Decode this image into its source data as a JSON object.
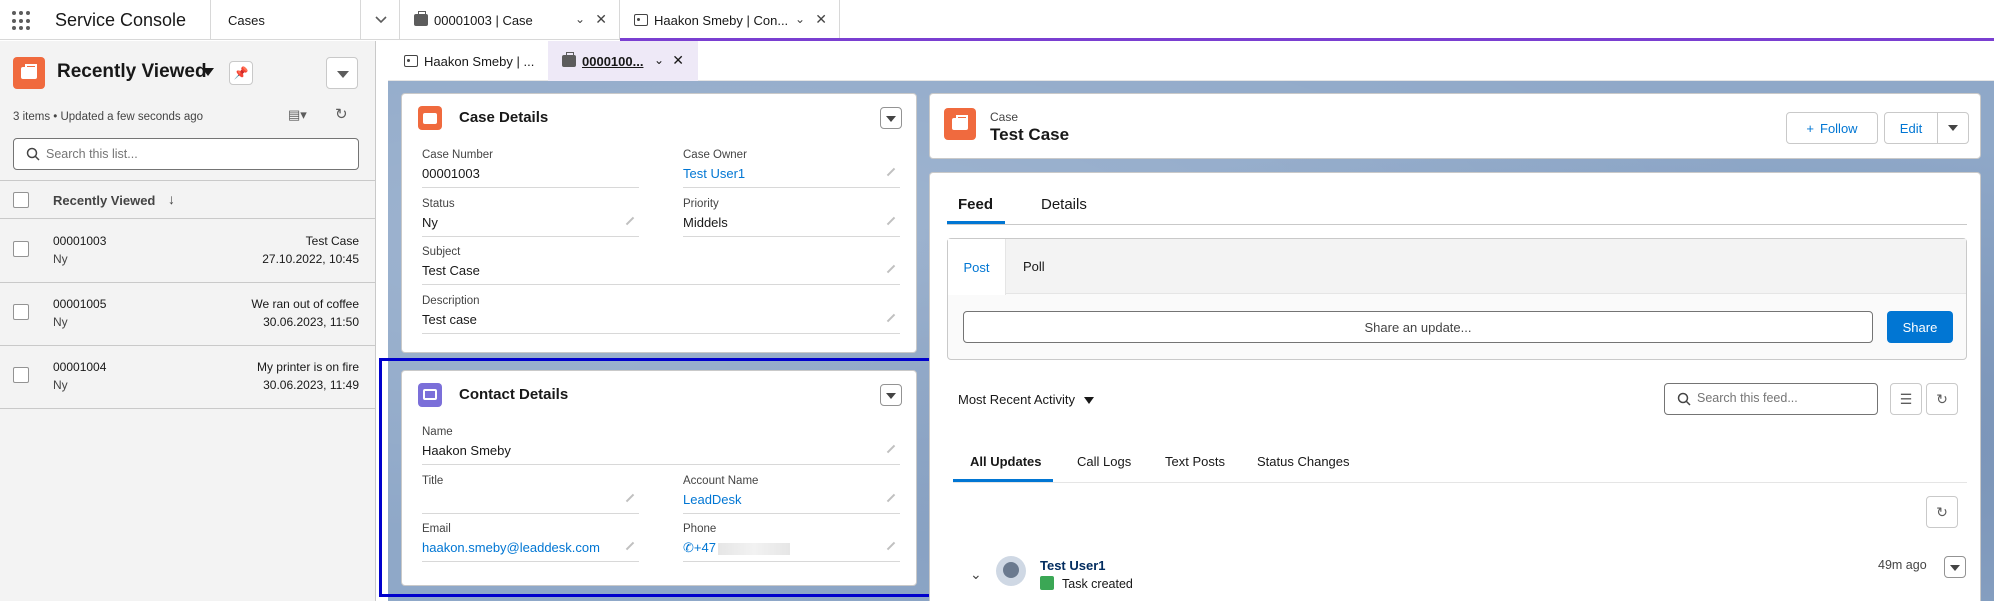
{
  "app": {
    "name": "Service Console",
    "nav_selected": "Cases"
  },
  "workspace_tabs": [
    {
      "label": "00001003 | Case",
      "icon": "case-icon"
    },
    {
      "label": "Haakon Smeby | Con...",
      "icon": "contact-icon"
    }
  ],
  "sub_tabs": [
    {
      "label": "Haakon Smeby | ...",
      "icon": "contact-icon"
    },
    {
      "label": "0000100...",
      "icon": "case-icon"
    }
  ],
  "list_view": {
    "title": "Recently Viewed",
    "meta": "3 items • Updated a few seconds ago",
    "search_placeholder": "Search this list...",
    "column_header": "Recently Viewed",
    "rows": [
      {
        "number": "00001003",
        "status": "Ny",
        "subject": "Test Case",
        "date": "27.10.2022, 10:45"
      },
      {
        "number": "00001005",
        "status": "Ny",
        "subject": "We ran out of coffee",
        "date": "30.06.2023, 11:50"
      },
      {
        "number": "00001004",
        "status": "Ny",
        "subject": "My printer is on fire",
        "date": "30.06.2023, 11:49"
      }
    ]
  },
  "case_details": {
    "title": "Case Details",
    "case_number_label": "Case Number",
    "case_number": "00001003",
    "case_owner_label": "Case Owner",
    "case_owner": "Test User1",
    "status_label": "Status",
    "status": "Ny",
    "priority_label": "Priority",
    "priority": "Middels",
    "subject_label": "Subject",
    "subject": "Test Case",
    "description_label": "Description",
    "description": "Test case"
  },
  "contact_details": {
    "title": "Contact Details",
    "name_label": "Name",
    "name": "Haakon Smeby",
    "title_label": "Title",
    "title_value": "",
    "account_label": "Account Name",
    "account": "LeadDesk",
    "email_label": "Email",
    "email": "haakon.smeby@leaddesk.com",
    "phone_label": "Phone",
    "phone": "+47"
  },
  "highlights": {
    "type": "Case",
    "name": "Test Case",
    "follow_label": "Follow",
    "edit_label": "Edit"
  },
  "feed": {
    "tabs": [
      "Feed",
      "Details"
    ],
    "publisher_tabs": [
      "Post",
      "Poll"
    ],
    "share_placeholder": "Share an update...",
    "share_button": "Share",
    "sort_label": "Most Recent Activity",
    "search_placeholder": "Search this feed...",
    "update_tabs": [
      "All Updates",
      "Call Logs",
      "Text Posts",
      "Status Changes"
    ],
    "post": {
      "user": "Test User1",
      "text": "Task created",
      "time": "49m ago"
    }
  },
  "colors": {
    "brand_blue": "#0176d3",
    "case_orange": "#f06a3e",
    "contact_purple": "#7b6fd9",
    "highlight_border": "#0000cc"
  }
}
